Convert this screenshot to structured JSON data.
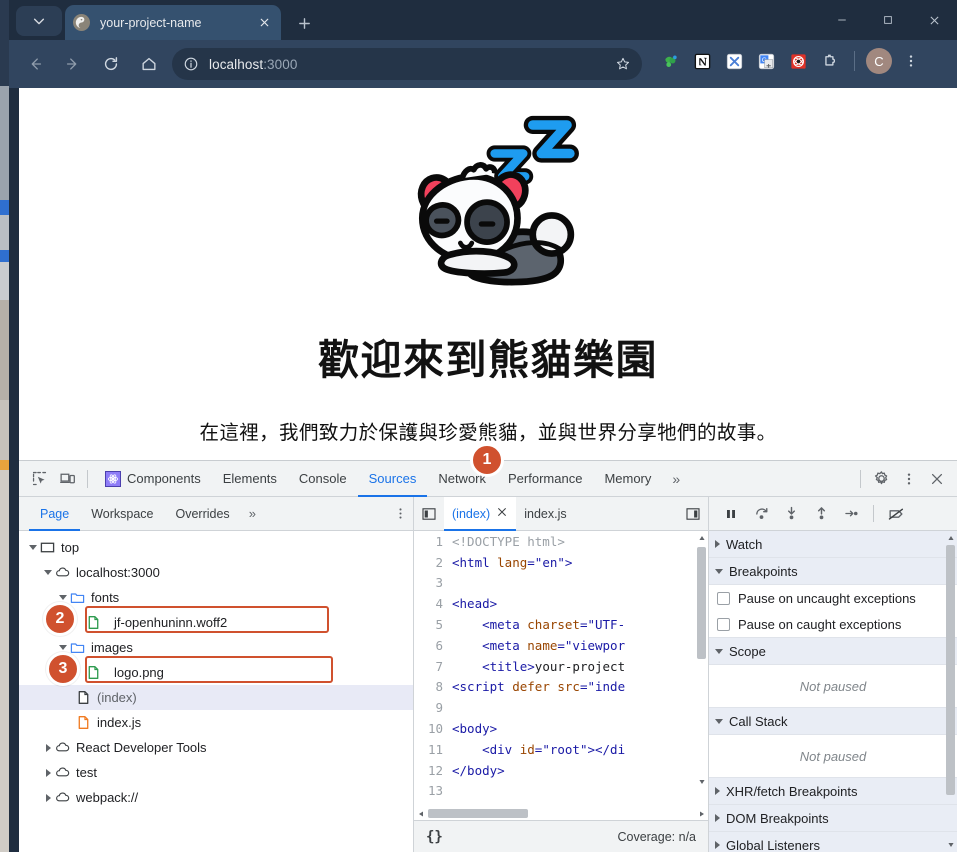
{
  "browser": {
    "tab": {
      "title": "your-project-name",
      "favicon": "globe-icon"
    },
    "newtab_label": "+",
    "window_controls": {
      "minimize": "–",
      "maximize": "□",
      "close": "✕"
    },
    "toolbar": {
      "back": "back-arrow",
      "forward": "forward-arrow",
      "reload": "reload-icon",
      "home": "home-icon",
      "url_host": "localhost",
      "url_port": ":3000",
      "site_info": "info-icon",
      "bookmark": "star-icon"
    },
    "extensions": [
      {
        "name": "evernote-extension",
        "letter": ""
      },
      {
        "name": "notion-extension",
        "letter": "N"
      },
      {
        "name": "x-extension",
        "letter": "X"
      },
      {
        "name": "google-translate-extension",
        "letter": "G"
      },
      {
        "name": "red-extension",
        "letter": ""
      },
      {
        "name": "extensions-puzzle-icon",
        "letter": ""
      }
    ],
    "profile_avatar": "C",
    "menu": "kebab-menu"
  },
  "page": {
    "logo_alt": "sleeping-panda-logo",
    "sleep_marks": [
      "z",
      "Z"
    ],
    "headline": "歡迎來到熊貓樂園",
    "subline": "在這裡，我們致力於保護與珍愛熊貓，並與世界分享牠們的故事。"
  },
  "devtools": {
    "tabs": [
      {
        "label": "Components",
        "active": false,
        "icon": "react-components-icon"
      },
      {
        "label": "Elements",
        "active": false
      },
      {
        "label": "Console",
        "active": false
      },
      {
        "label": "Sources",
        "active": true
      },
      {
        "label": "Network",
        "active": false
      },
      {
        "label": "Performance",
        "active": false
      },
      {
        "label": "Memory",
        "active": false
      }
    ],
    "more_tabs": "»",
    "settings": "gear-icon",
    "kebab": "kebab-menu",
    "close": "close-icon",
    "inspect": "inspect-element-icon",
    "device": "device-toolbar-icon",
    "sources_nav": {
      "tabs": [
        {
          "label": "Page",
          "active": true
        },
        {
          "label": "Workspace",
          "active": false
        },
        {
          "label": "Overrides",
          "active": false
        }
      ],
      "more": "»",
      "kebab": "kebab-menu"
    },
    "editor_tabs": [
      {
        "label": "(index)",
        "active": true,
        "closable": true
      },
      {
        "label": "index.js",
        "active": false,
        "closable": false
      }
    ],
    "pane_toggle_left": "show-navigator-icon",
    "pane_toggle_right": "show-debugger-icon",
    "debug_controls": [
      {
        "name": "pause-resume-button",
        "glyph": "pause"
      },
      {
        "name": "step-over-button",
        "glyph": "step-over"
      },
      {
        "name": "step-into-button",
        "glyph": "step-into"
      },
      {
        "name": "step-out-button",
        "glyph": "step-out"
      },
      {
        "name": "step-button",
        "glyph": "step"
      },
      {
        "name": "deactivate-breakpoints-button",
        "glyph": "breakpoint-off"
      }
    ],
    "file_tree": [
      {
        "label": "top",
        "depth": 0,
        "icon": "frame-icon",
        "twisty": "down",
        "selected": false
      },
      {
        "label": "localhost:3000",
        "depth": 1,
        "icon": "cloud-icon",
        "twisty": "down",
        "selected": false
      },
      {
        "label": "fonts",
        "depth": 2,
        "icon": "folder-icon",
        "twisty": "down",
        "selected": false
      },
      {
        "label": "jf-openhuninn.woff2",
        "depth": 3,
        "icon": "file-green-icon",
        "twisty": "none",
        "selected": false,
        "highlight": true,
        "badge": "2"
      },
      {
        "label": "images",
        "depth": 2,
        "icon": "folder-icon",
        "twisty": "down",
        "selected": false
      },
      {
        "label": "logo.png",
        "depth": 3,
        "icon": "file-green-icon",
        "twisty": "none",
        "selected": false,
        "highlight": true,
        "badge": "3"
      },
      {
        "label": "(index)",
        "depth": 3,
        "icon": "file-gray-icon",
        "twisty": "none",
        "selected": true
      },
      {
        "label": "index.js",
        "depth": 3,
        "icon": "file-orange-icon",
        "twisty": "none",
        "selected": false
      },
      {
        "label": "React Developer Tools",
        "depth": 1,
        "icon": "cloud-icon",
        "twisty": "right",
        "selected": false
      },
      {
        "label": "test",
        "depth": 1,
        "icon": "cloud-icon",
        "twisty": "right",
        "selected": false
      },
      {
        "label": "webpack://",
        "depth": 1,
        "icon": "cloud-icon",
        "twisty": "right",
        "selected": false
      }
    ],
    "code_lines": [
      {
        "n": 1,
        "tokens": [
          {
            "t": "doctype",
            "v": "<!DOCTYPE html>"
          }
        ]
      },
      {
        "n": 2,
        "tokens": [
          {
            "t": "tag",
            "v": "<html "
          },
          {
            "t": "attr",
            "v": "lang"
          },
          {
            "t": "punct",
            "v": "="
          },
          {
            "t": "str",
            "v": "\"en\""
          },
          {
            "t": "tag",
            "v": ">"
          }
        ]
      },
      {
        "n": 3,
        "tokens": []
      },
      {
        "n": 4,
        "tokens": [
          {
            "t": "tag",
            "v": "<head>"
          }
        ]
      },
      {
        "n": 5,
        "tokens": [
          {
            "t": "tag",
            "v": "    <meta "
          },
          {
            "t": "attr",
            "v": "charset"
          },
          {
            "t": "punct",
            "v": "="
          },
          {
            "t": "str",
            "v": "\"UTF-"
          }
        ]
      },
      {
        "n": 6,
        "tokens": [
          {
            "t": "tag",
            "v": "    <meta "
          },
          {
            "t": "attr",
            "v": "name"
          },
          {
            "t": "punct",
            "v": "="
          },
          {
            "t": "str",
            "v": "\"viewpor"
          }
        ]
      },
      {
        "n": 7,
        "tokens": [
          {
            "t": "tag",
            "v": "    <title>"
          },
          {
            "t": "plain",
            "v": "your-project"
          }
        ]
      },
      {
        "n": 8,
        "tokens": [
          {
            "t": "tag",
            "v": "<script "
          },
          {
            "t": "attr",
            "v": "defer src"
          },
          {
            "t": "punct",
            "v": "="
          },
          {
            "t": "str",
            "v": "\"inde"
          }
        ]
      },
      {
        "n": 9,
        "tokens": []
      },
      {
        "n": 10,
        "tokens": [
          {
            "t": "tag",
            "v": "<body>"
          }
        ]
      },
      {
        "n": 11,
        "tokens": [
          {
            "t": "tag",
            "v": "    <div "
          },
          {
            "t": "attr",
            "v": "id"
          },
          {
            "t": "punct",
            "v": "="
          },
          {
            "t": "str",
            "v": "\"root\""
          },
          {
            "t": "tag",
            "v": "></di"
          }
        ]
      },
      {
        "n": 12,
        "tokens": [
          {
            "t": "tag",
            "v": "</body>"
          }
        ]
      },
      {
        "n": 13,
        "tokens": []
      }
    ],
    "editor_status": {
      "pretty_print": "{}",
      "coverage": "Coverage: n/a"
    },
    "debugger_sections": [
      {
        "label": "Watch",
        "expanded": false,
        "type": "header"
      },
      {
        "label": "Breakpoints",
        "expanded": true,
        "type": "header"
      },
      {
        "label": "Pause on uncaught exceptions",
        "type": "checkbox",
        "checked": false
      },
      {
        "label": "Pause on caught exceptions",
        "type": "checkbox",
        "checked": false
      },
      {
        "label": "Scope",
        "expanded": true,
        "type": "header"
      },
      {
        "label": "Not paused",
        "type": "empty"
      },
      {
        "label": "Call Stack",
        "expanded": true,
        "type": "header"
      },
      {
        "label": "Not paused",
        "type": "empty"
      },
      {
        "label": "XHR/fetch Breakpoints",
        "expanded": false,
        "type": "header"
      },
      {
        "label": "DOM Breakpoints",
        "expanded": false,
        "type": "header"
      },
      {
        "label": "Global Listeners",
        "expanded": false,
        "type": "header"
      }
    ]
  },
  "annotations": [
    {
      "number": "1",
      "target": "sources-tab"
    },
    {
      "number": "2",
      "target": "fonts-file"
    },
    {
      "number": "3",
      "target": "images-file"
    }
  ],
  "colors": {
    "browser_chrome": "#1f2d3f",
    "toolbar": "#31455f",
    "accent_blue": "#1a73e8",
    "annotation": "#d0512e",
    "devtools_bg": "#f1f3f4"
  }
}
